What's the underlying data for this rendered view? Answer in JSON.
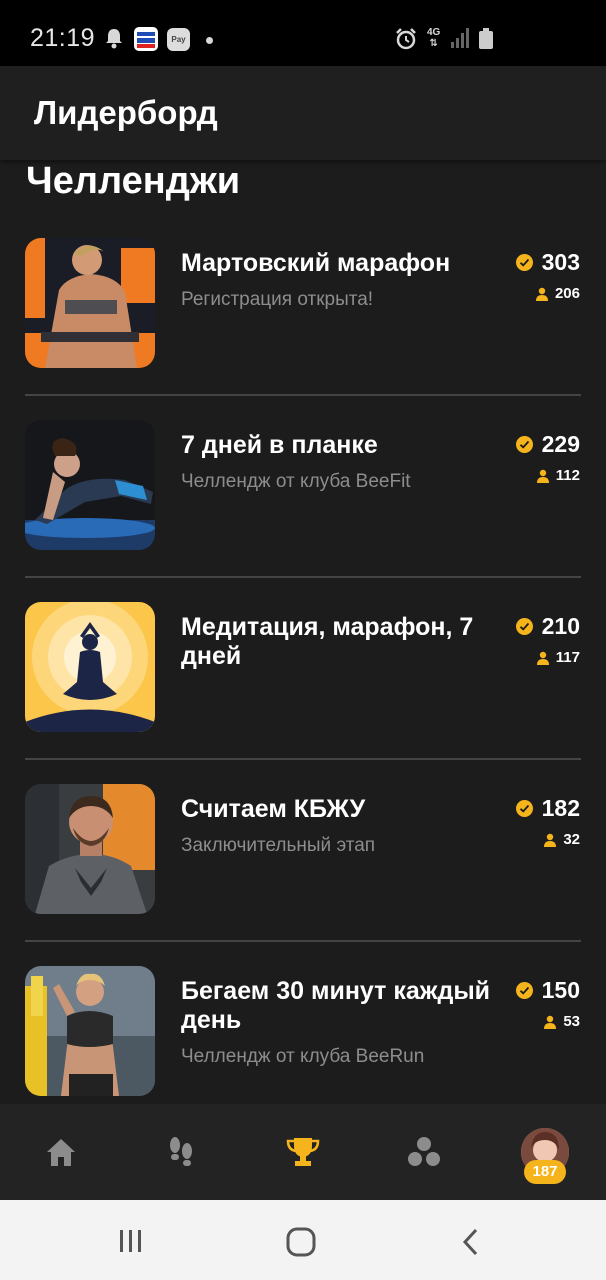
{
  "status_bar": {
    "time": "21:19",
    "network": "4G",
    "icons": [
      "bell-icon",
      "pdd-app-icon",
      "pay-icon",
      "dot-icon",
      "alarm-icon",
      "4g-icon",
      "signal-icon",
      "battery-icon"
    ]
  },
  "header": {
    "title": "Лидерборд"
  },
  "section": {
    "title": "Челленджи"
  },
  "challenges": [
    {
      "title": "Мартовский марафон",
      "subtitle": "Регистрация открыта!",
      "points": "303",
      "participants": "206"
    },
    {
      "title": "7 дней в планке",
      "subtitle": "Челлендж от клуба BeeFit",
      "points": "229",
      "participants": "112"
    },
    {
      "title": "Медитация, марафон, 7 дней",
      "subtitle": "",
      "points": "210",
      "participants": "117"
    },
    {
      "title": "Считаем КБЖУ",
      "subtitle": "Заключительный этап",
      "points": "182",
      "participants": "32"
    },
    {
      "title": "Бегаем 30 минут каждый день",
      "subtitle": "Челлендж от клуба BeeRun",
      "points": "150",
      "participants": "53"
    }
  ],
  "bottom_nav": {
    "items": [
      "home-icon",
      "footsteps-icon",
      "trophy-icon",
      "community-icon",
      "avatar"
    ],
    "active": "trophy-icon",
    "profile_badge": "187"
  },
  "colors": {
    "accent": "#f6b41c",
    "background": "#1c1c1c",
    "muted_text": "#8d8d8d"
  }
}
